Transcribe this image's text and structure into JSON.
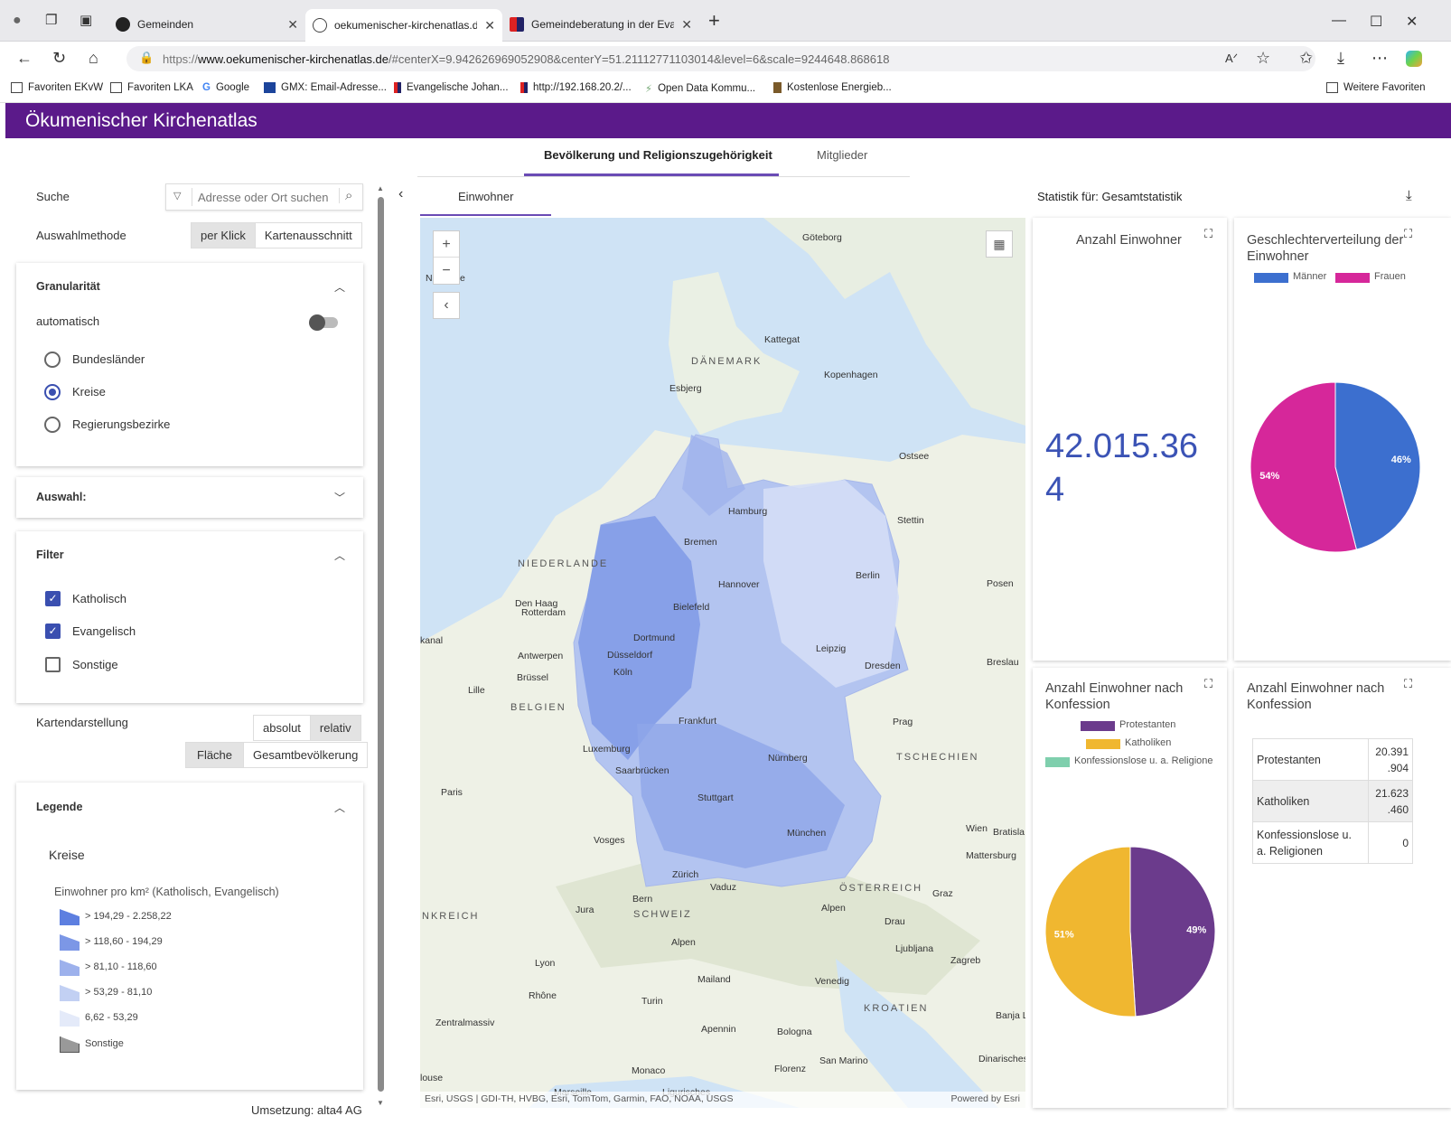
{
  "browser": {
    "tabs": [
      {
        "title": "Gemeinden"
      },
      {
        "title": "oekumenischer-kirchenatlas.de/#"
      },
      {
        "title": "Gemeindeberatung in der Evange"
      }
    ],
    "url_prefix": "https://",
    "url_host": "www.oekumenischer-kirchenatlas.de",
    "url_rest": "/#centerX=9.942626969052908&centerY=51.21112771103014&level=6&scale=9244648.868618",
    "bookmarks": [
      "Favoriten EKvW",
      "Favoriten LKA",
      "Google",
      "GMX: Email-Adresse...",
      "Evangelische Johan...",
      "http://192.168.20.2/...",
      "Open Data Kommu...",
      "Kostenlose Energieb..."
    ],
    "other_favorites": "Weitere Favoriten"
  },
  "app": {
    "title": "Ökumenischer Kirchenatlas",
    "top_tabs": [
      "Bevölkerung und Religionszugehörigkeit",
      "Mitglieder"
    ],
    "sub_tab": "Einwohner",
    "stat_for": "Statistik für: Gesamtstatistik",
    "credit": "Umsetzung: alta4 AG"
  },
  "left": {
    "search_label": "Suche",
    "search_placeholder": "Adresse oder Ort suchen",
    "method_label": "Auswahlmethode",
    "method_options": [
      "per Klick",
      "Kartenausschnitt"
    ],
    "granularity": {
      "title": "Granularität",
      "auto_label": "automatisch",
      "options": [
        "Bundesländer",
        "Kreise",
        "Regierungsbezirke"
      ],
      "selected": "Kreise"
    },
    "selection_title": "Auswahl:",
    "filter": {
      "title": "Filter",
      "options": [
        {
          "label": "Katholisch",
          "checked": true
        },
        {
          "label": "Evangelisch",
          "checked": true
        },
        {
          "label": "Sonstige",
          "checked": false
        }
      ]
    },
    "map_display": {
      "label": "Kartendarstellung",
      "mode_options": [
        "absolut",
        "relativ"
      ],
      "base_options": [
        "Fläche",
        "Gesamtbevölkerung"
      ]
    },
    "legend": {
      "title": "Legende",
      "layer": "Kreise",
      "subtitle": "Einwohner pro km² (Katholisch, Evangelisch)",
      "items": [
        {
          "label": "> 194,29 - 2.258,22",
          "color": "#5d7fe0"
        },
        {
          "label": "> 118,60 - 194,29",
          "color": "#7c97e6"
        },
        {
          "label": "> 81,10 - 118,60",
          "color": "#9db1ec"
        },
        {
          "label": "> 53,29 - 81,10",
          "color": "#c2d0f3"
        },
        {
          "label": "6,62 - 53,29",
          "color": "#e4eaf9"
        },
        {
          "label": "Sonstige",
          "color": "#999999"
        }
      ]
    }
  },
  "map": {
    "zoom_in": "+",
    "zoom_out": "−",
    "attribution": "Esri, USGS | GDI-TH, HVBG, Esri, TomTom, Garmin, FAO, NOAA, USGS",
    "powered": "Powered by Esri",
    "countries": [
      "DÄNEMARK",
      "NIEDERLANDE",
      "BELGIEN",
      "TSCHECHIEN",
      "ÖSTERREICH",
      "SCHWEIZ",
      "KROATIEN",
      "NKREICH"
    ],
    "cities": [
      "Göteborg",
      "Kattegat",
      "Kopenhagen",
      "Esbjerg",
      "Ostsee",
      "Hamburg",
      "Stettin",
      "Bremen",
      "Berlin",
      "Posen",
      "Hannover",
      "Den Haag",
      "Rotterdam",
      "Bielefeld",
      "Dortmund",
      "Antwerpen",
      "Düsseldorf",
      "Leipzig",
      "Brüssel",
      "Köln",
      "Dresden",
      "Breslau",
      "Lille",
      "Frankfurt",
      "Prag",
      "Luxemburg",
      "Saarbrücken",
      "Nürnberg",
      "Paris",
      "Stuttgart",
      "Wien",
      "Bratisla",
      "Vosges",
      "München",
      "Mattersburg",
      "Zürich",
      "Vaduz",
      "Graz",
      "Bern",
      "Alpen",
      "Jura",
      "Drau",
      "Ljubljana",
      "Zagreb",
      "Lyon",
      "Mailand",
      "Venedig",
      "Turin",
      "Rhône",
      "Zentralmassiv",
      "Bologna",
      "Banja L",
      "Apennin",
      "San Marino",
      "Florenz",
      "Monaco",
      "louse",
      "Marseille",
      "Ligurisches",
      "Dinarisches",
      "Alpen",
      "kanal",
      "N",
      "e"
    ]
  },
  "stats": {
    "einwohner": {
      "title": "Anzahl Einwohner",
      "value_line1": "42.015.36",
      "value_line2": "4"
    },
    "gender": {
      "title_line1": "Geschlechterverteilung der",
      "title_line2": "Einwohner",
      "legend": [
        "Männer",
        "Frauen"
      ],
      "colors": {
        "men": "#3c6fcf",
        "women": "#d6279a"
      }
    },
    "konfession_pie": {
      "title_line1": "Anzahl Einwohner nach",
      "title_line2": "Konfession",
      "legend": [
        "Protestanten",
        "Katholiken",
        "Konfessionslose u. a. Religione"
      ],
      "colors": {
        "prot": "#6b3b8c",
        "kath": "#f0b730",
        "none": "#7fcfad"
      }
    },
    "konfession_table": {
      "title_line1": "Anzahl Einwohner nach",
      "title_line2": "Konfession",
      "rows": [
        {
          "name": "Protestanten",
          "value_a": "20.391",
          "value_b": ".904"
        },
        {
          "name": "Katholiken",
          "value_a": "21.623",
          "value_b": ".460"
        },
        {
          "name_a": "Konfessionslose u.",
          "name_b": "a. Religionen",
          "value_a": "0"
        }
      ]
    }
  },
  "chart_data": [
    {
      "type": "pie",
      "categories": [
        "Männer",
        "Frauen"
      ],
      "values": [
        46,
        54
      ],
      "value_labels": [
        "46%",
        "54%"
      ]
    },
    {
      "type": "pie",
      "categories": [
        "Protestanten",
        "Katholiken"
      ],
      "values": [
        49,
        51
      ],
      "value_labels": [
        "49%",
        "51%"
      ]
    }
  ]
}
